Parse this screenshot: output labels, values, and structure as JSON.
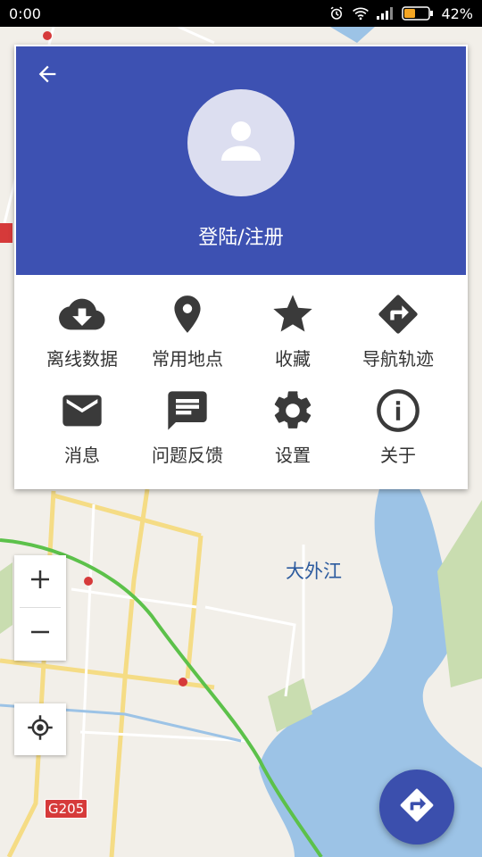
{
  "status_bar": {
    "time": "0:00",
    "battery_percent": "42%",
    "icons": [
      "alarm-icon",
      "wifi-icon",
      "signal-icon",
      "battery-icon"
    ]
  },
  "header": {
    "back_icon": "arrow-left-icon",
    "avatar_icon": "person-icon",
    "login_label": "登陆/注册"
  },
  "menu": {
    "items": [
      {
        "icon": "cloud-download-icon",
        "label": "离线数据"
      },
      {
        "icon": "map-pin-icon",
        "label": "常用地点"
      },
      {
        "icon": "star-icon",
        "label": "收藏"
      },
      {
        "icon": "navigation-arrow-icon",
        "label": "导航轨迹"
      },
      {
        "icon": "mail-icon",
        "label": "消息"
      },
      {
        "icon": "feedback-icon",
        "label": "问题反馈"
      },
      {
        "icon": "gear-icon",
        "label": "设置"
      },
      {
        "icon": "info-icon",
        "label": "关于"
      }
    ]
  },
  "map": {
    "place_label": "大外江",
    "road_sign": "G205",
    "zoom_in": "+",
    "zoom_out": "−"
  },
  "colors": {
    "header_bg": "#3d51b2",
    "fab_bg": "#3b4fad",
    "water": "#9cc3e6",
    "road": "#f5dc85",
    "route": "#5cc14a",
    "park": "#c9ddb0"
  }
}
